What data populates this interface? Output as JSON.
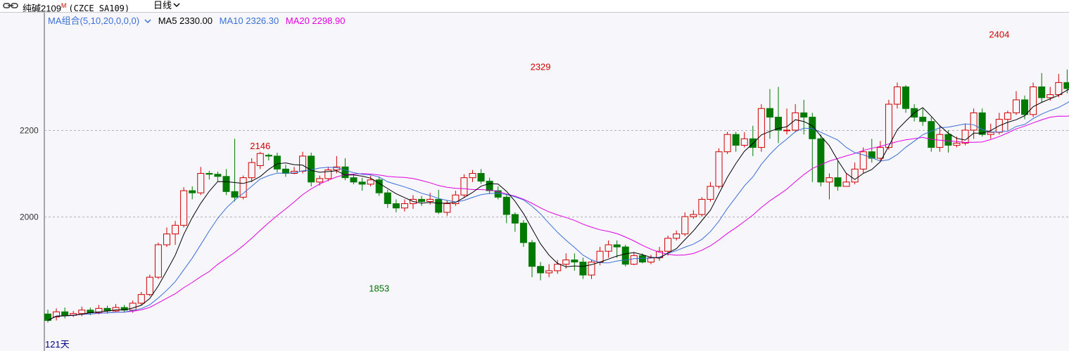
{
  "header": {
    "title": "纯碱2109",
    "superscript": "M",
    "code": "(CZCE  SA109)",
    "period": "日线",
    "period_arrow": "chevron-down-icon"
  },
  "legend": {
    "group": "MA组合(5,10,20,0,0,0)",
    "ma5": "MA5 2330.00",
    "ma10": "MA10 2326.30",
    "ma20": "MA20 2298.90"
  },
  "footer": {
    "days": "121天"
  },
  "chart_data": {
    "type": "candlestick",
    "y_tick_labels": [
      "2200",
      "2000"
    ],
    "y_ticks": [
      2200,
      2000
    ],
    "ylim": [
      1720,
      2480
    ],
    "grid": "dashed",
    "colors": {
      "up": "#d00000",
      "down": "#007a00",
      "ma5": "#000000",
      "ma10": "#3a6fd8",
      "ma20": "#e000e0"
    },
    "annotations": [
      {
        "label": "2146",
        "value": 2146,
        "index": 25,
        "kind": "high"
      },
      {
        "label": "1853",
        "value": 1853,
        "index": 39,
        "kind": "low"
      },
      {
        "label": "2329",
        "value": 2329,
        "index": 58,
        "kind": "high"
      },
      {
        "label": "2404",
        "value": 2404,
        "index": 112,
        "kind": "high"
      }
    ],
    "candles": [
      [
        1775,
        1760,
        1785,
        1755
      ],
      [
        1768,
        1780,
        1788,
        1760
      ],
      [
        1780,
        1772,
        1790,
        1765
      ],
      [
        1772,
        1776,
        1782,
        1768
      ],
      [
        1776,
        1784,
        1792,
        1770
      ],
      [
        1784,
        1778,
        1790,
        1772
      ],
      [
        1778,
        1788,
        1796,
        1774
      ],
      [
        1788,
        1782,
        1794,
        1776
      ],
      [
        1782,
        1790,
        1798,
        1778
      ],
      [
        1790,
        1784,
        1796,
        1778
      ],
      [
        1784,
        1800,
        1806,
        1778
      ],
      [
        1800,
        1820,
        1826,
        1796
      ],
      [
        1820,
        1860,
        1866,
        1816
      ],
      [
        1860,
        1935,
        1940,
        1856
      ],
      [
        1935,
        1960,
        1975,
        1930
      ],
      [
        1960,
        1980,
        1990,
        1935
      ],
      [
        1980,
        2060,
        2068,
        1975
      ],
      [
        2060,
        2055,
        2070,
        2040
      ],
      [
        2055,
        2100,
        2115,
        2050
      ],
      [
        2100,
        2098,
        2106,
        2086
      ],
      [
        2098,
        2093,
        2104,
        2082
      ],
      [
        2093,
        2058,
        2110,
        2050
      ],
      [
        2058,
        2045,
        2180,
        2035
      ],
      [
        2045,
        2090,
        2095,
        2040
      ],
      [
        2090,
        2125,
        2135,
        2080
      ],
      [
        2118,
        2146,
        2150,
        2110
      ],
      [
        2142,
        2140,
        2146,
        2130
      ],
      [
        2140,
        2110,
        2148,
        2102
      ],
      [
        2110,
        2100,
        2120,
        2092
      ],
      [
        2100,
        2105,
        2115,
        2098
      ],
      [
        2105,
        2140,
        2150,
        2100
      ],
      [
        2140,
        2080,
        2148,
        2070
      ],
      [
        2080,
        2088,
        2095,
        2072
      ],
      [
        2088,
        2108,
        2115,
        2082
      ],
      [
        2108,
        2115,
        2140,
        2100
      ],
      [
        2115,
        2090,
        2135,
        2084
      ],
      [
        2090,
        2080,
        2098,
        2075
      ],
      [
        2080,
        2075,
        2090,
        2060
      ],
      [
        2075,
        2085,
        2095,
        2070
      ],
      [
        2085,
        2055,
        2093,
        2048
      ],
      [
        2055,
        2030,
        2062,
        2020
      ],
      [
        2030,
        2020,
        2040,
        2010
      ],
      [
        2020,
        2030,
        2040,
        2012
      ],
      [
        2030,
        2040,
        2050,
        2018
      ],
      [
        2040,
        2035,
        2048,
        2025
      ],
      [
        2035,
        2040,
        2055,
        2028
      ],
      [
        2040,
        2010,
        2062,
        2006
      ],
      [
        2010,
        2030,
        2038,
        2002
      ],
      [
        2030,
        2050,
        2060,
        2025
      ],
      [
        2050,
        2090,
        2098,
        2045
      ],
      [
        2090,
        2100,
        2108,
        2080
      ],
      [
        2100,
        2082,
        2110,
        2076
      ],
      [
        2082,
        2060,
        2090,
        2052
      ],
      [
        2060,
        2045,
        2070,
        2040
      ],
      [
        2045,
        2005,
        2052,
        1985
      ],
      [
        2005,
        1985,
        2010,
        1965
      ],
      [
        1985,
        1940,
        1992,
        1930
      ],
      [
        1940,
        1885,
        1946,
        1860
      ],
      [
        1885,
        1870,
        1895,
        1853
      ],
      [
        1870,
        1875,
        1890,
        1860
      ],
      [
        1875,
        1890,
        1900,
        1868
      ],
      [
        1890,
        1900,
        1915,
        1880
      ],
      [
        1900,
        1895,
        1915,
        1875
      ],
      [
        1895,
        1865,
        1905,
        1856
      ],
      [
        1865,
        1895,
        1900,
        1856
      ],
      [
        1895,
        1920,
        1930,
        1888
      ],
      [
        1920,
        1935,
        1945,
        1905
      ],
      [
        1935,
        1930,
        1945,
        1905
      ],
      [
        1930,
        1890,
        1935,
        1885
      ],
      [
        1890,
        1910,
        1918,
        1888
      ],
      [
        1910,
        1895,
        1915,
        1892
      ],
      [
        1895,
        1905,
        1912,
        1890
      ],
      [
        1905,
        1920,
        1930,
        1898
      ],
      [
        1920,
        1950,
        1956,
        1910
      ],
      [
        1950,
        1960,
        1968,
        1945
      ],
      [
        1960,
        2000,
        2010,
        1955
      ],
      [
        2000,
        2005,
        2015,
        1995
      ],
      [
        2005,
        2040,
        2045,
        2000
      ],
      [
        2040,
        2070,
        2080,
        2035
      ],
      [
        2070,
        2150,
        2158,
        2065
      ],
      [
        2150,
        2190,
        2196,
        2145
      ],
      [
        2190,
        2165,
        2196,
        2150
      ],
      [
        2165,
        2180,
        2195,
        2160
      ],
      [
        2180,
        2160,
        2210,
        2140
      ],
      [
        2160,
        2250,
        2260,
        2150
      ],
      [
        2250,
        2230,
        2295,
        2180
      ],
      [
        2230,
        2200,
        2300,
        2170
      ],
      [
        2200,
        2200,
        2250,
        2190
      ],
      [
        2200,
        2240,
        2260,
        2195
      ],
      [
        2240,
        2230,
        2270,
        2190
      ],
      [
        2230,
        2180,
        2240,
        2080
      ],
      [
        2180,
        2080,
        2190,
        2070
      ],
      [
        2080,
        2090,
        2100,
        2040
      ],
      [
        2090,
        2070,
        2130,
        2060
      ],
      [
        2070,
        2080,
        2100,
        2070
      ],
      [
        2080,
        2110,
        2125,
        2075
      ],
      [
        2110,
        2150,
        2160,
        2100
      ],
      [
        2150,
        2135,
        2180,
        2125
      ],
      [
        2135,
        2160,
        2175,
        2130
      ],
      [
        2160,
        2260,
        2270,
        2155
      ],
      [
        2260,
        2300,
        2310,
        2250
      ],
      [
        2300,
        2250,
        2304,
        2240
      ],
      [
        2250,
        2230,
        2260,
        2220
      ],
      [
        2230,
        2220,
        2250,
        2210
      ],
      [
        2220,
        2160,
        2230,
        2150
      ],
      [
        2160,
        2190,
        2210,
        2150
      ],
      [
        2190,
        2165,
        2200,
        2148
      ],
      [
        2165,
        2170,
        2185,
        2160
      ],
      [
        2170,
        2200,
        2215,
        2165
      ],
      [
        2200,
        2240,
        2250,
        2180
      ],
      [
        2240,
        2190,
        2250,
        2185
      ],
      [
        2190,
        2195,
        2215,
        2180
      ],
      [
        2195,
        2225,
        2240,
        2190
      ],
      [
        2225,
        2240,
        2245,
        2200
      ],
      [
        2240,
        2270,
        2290,
        2235
      ],
      [
        2270,
        2236,
        2280,
        2225
      ],
      [
        2236,
        2300,
        2310,
        2230
      ],
      [
        2300,
        2275,
        2332,
        2265
      ],
      [
        2275,
        2282,
        2300,
        2268
      ],
      [
        2282,
        2310,
        2330,
        2276
      ],
      [
        2310,
        2296,
        2340,
        2285
      ],
      [
        2296,
        2330,
        2360,
        2290
      ],
      [
        2330,
        2390,
        2395,
        2325
      ],
      [
        2390,
        2404,
        2404,
        2375
      ],
      [
        2380,
        2355,
        2395,
        2340
      ],
      [
        2355,
        2290,
        2365,
        2280
      ],
      [
        2290,
        2330,
        2340,
        2285
      ]
    ]
  }
}
